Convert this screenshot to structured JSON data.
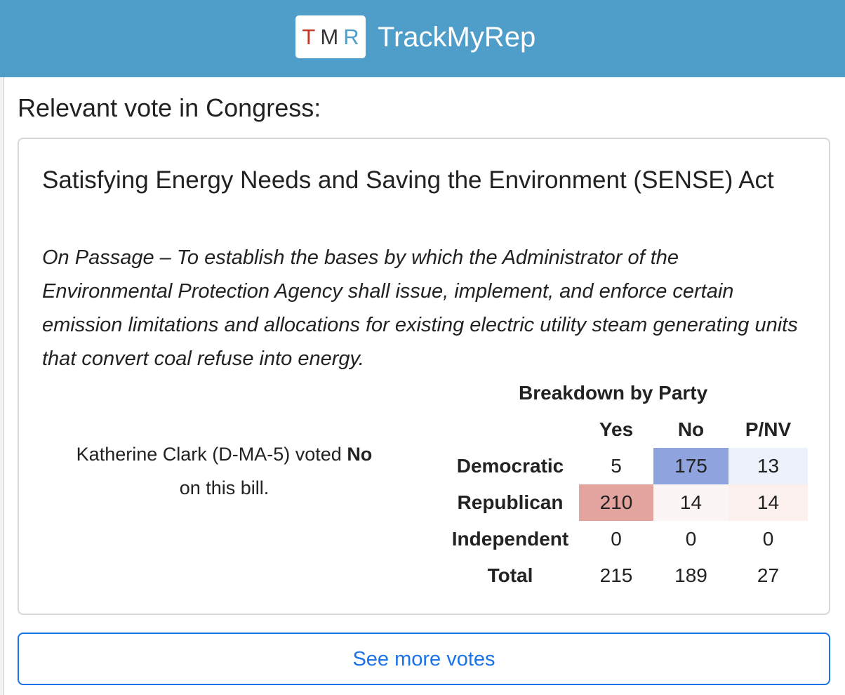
{
  "header": {
    "logo_letters": [
      "T",
      "M",
      "R"
    ],
    "app_name": "TrackMyRep",
    "background_color": "#4f9dc9"
  },
  "section_heading": "Relevant vote in Congress:",
  "bill": {
    "title": "Satisfying Energy Needs and Saving the Environment (SENSE) Act",
    "description": "On Passage – To establish the bases by which the Administrator of the Environmental Protection Agency shall issue, implement, and enforce certain emission limitations and allocations for existing electric utility steam generating units that convert coal refuse into energy."
  },
  "vote": {
    "statement_prefix": "Katherine Clark (D-MA-5) voted",
    "vote_value": "No",
    "statement_suffix": "on this bill."
  },
  "breakdown": {
    "title": "Breakdown by Party",
    "columns": [
      "Yes",
      "No",
      "P/NV"
    ],
    "rows": [
      {
        "party": "Democratic",
        "values": [
          "5",
          "175",
          "13"
        ],
        "colors": [
          "#ffffff",
          "#8fa4df",
          "#edf1fb"
        ]
      },
      {
        "party": "Republican",
        "values": [
          "210",
          "14",
          "14"
        ],
        "colors": [
          "#e3a39e",
          "#fcf5f5",
          "#fcf0ef"
        ]
      },
      {
        "party": "Independent",
        "values": [
          "0",
          "0",
          "0"
        ],
        "colors": [
          "#ffffff",
          "#ffffff",
          "#ffffff"
        ]
      },
      {
        "party": "Total",
        "values": [
          "215",
          "189",
          "27"
        ],
        "colors": [
          "#ffffff",
          "#ffffff",
          "#ffffff"
        ]
      }
    ]
  },
  "see_more_label": "See more votes",
  "colors": {
    "link_blue": "#1a73e8",
    "democratic_strong": "#8fa4df",
    "republican_strong": "#e3a39e"
  }
}
